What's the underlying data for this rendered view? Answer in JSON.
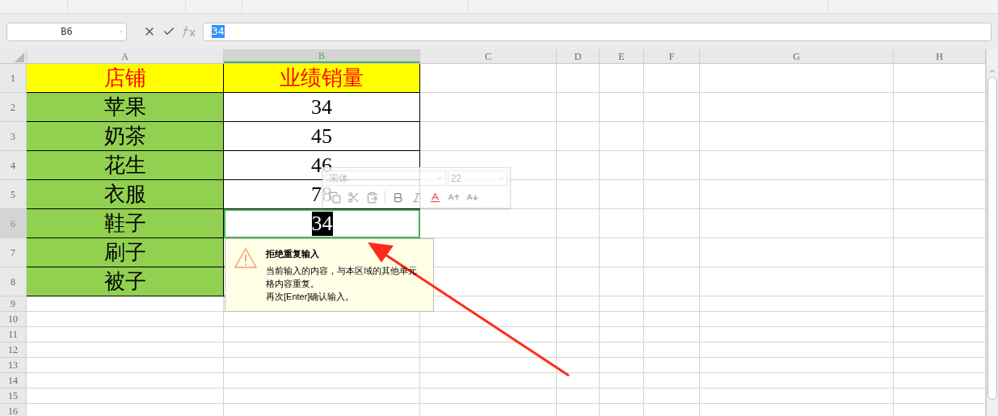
{
  "formula_bar": {
    "name_box": "B6",
    "formula": "34"
  },
  "columns": [
    {
      "label": "A",
      "selected": false
    },
    {
      "label": "B",
      "selected": true
    },
    {
      "label": "C",
      "selected": false
    },
    {
      "label": "D",
      "selected": false
    },
    {
      "label": "E",
      "selected": false
    },
    {
      "label": "F",
      "selected": false
    },
    {
      "label": "G",
      "selected": false
    },
    {
      "label": "H",
      "selected": false
    }
  ],
  "rows": [
    {
      "number": "1",
      "selected": false,
      "cells": [
        {
          "kind": "header",
          "text": "店铺"
        },
        {
          "kind": "header",
          "text": "业绩销量"
        }
      ]
    },
    {
      "number": "2",
      "selected": false,
      "cells": [
        {
          "kind": "label",
          "text": "苹果"
        },
        {
          "kind": "value",
          "text": "34"
        }
      ]
    },
    {
      "number": "3",
      "selected": false,
      "cells": [
        {
          "kind": "label",
          "text": "奶茶"
        },
        {
          "kind": "value",
          "text": "45"
        }
      ]
    },
    {
      "number": "4",
      "selected": false,
      "cells": [
        {
          "kind": "label",
          "text": "花生"
        },
        {
          "kind": "value",
          "text": "46"
        }
      ]
    },
    {
      "number": "5",
      "selected": false,
      "cells": [
        {
          "kind": "label",
          "text": "衣服"
        },
        {
          "kind": "value",
          "text": "78"
        }
      ]
    },
    {
      "number": "6",
      "selected": true,
      "cells": [
        {
          "kind": "label",
          "text": "鞋子"
        },
        {
          "kind": "editing",
          "text": "34"
        }
      ]
    },
    {
      "number": "7",
      "selected": false,
      "cells": [
        {
          "kind": "label",
          "text": "刷子"
        },
        {
          "kind": "empty"
        }
      ]
    },
    {
      "number": "8",
      "selected": false,
      "cells": [
        {
          "kind": "label",
          "text": "被子"
        },
        {
          "kind": "empty"
        }
      ]
    },
    {
      "number": "9",
      "selected": false,
      "cells": []
    },
    {
      "number": "10",
      "selected": false,
      "cells": []
    },
    {
      "number": "11",
      "selected": false,
      "cells": []
    },
    {
      "number": "12",
      "selected": false,
      "cells": []
    },
    {
      "number": "13",
      "selected": false,
      "cells": []
    },
    {
      "number": "14",
      "selected": false,
      "cells": []
    },
    {
      "number": "15",
      "selected": false,
      "cells": []
    },
    {
      "number": "16",
      "selected": false,
      "cells": []
    }
  ],
  "mini_toolbar": {
    "font": "宋体",
    "size": "22"
  },
  "validation_tip": {
    "title": "拒绝重复输入",
    "message": "当前输入的内容，与本区域的其他单元格内容重复。",
    "hint": "再次[Enter]确认输入。"
  }
}
